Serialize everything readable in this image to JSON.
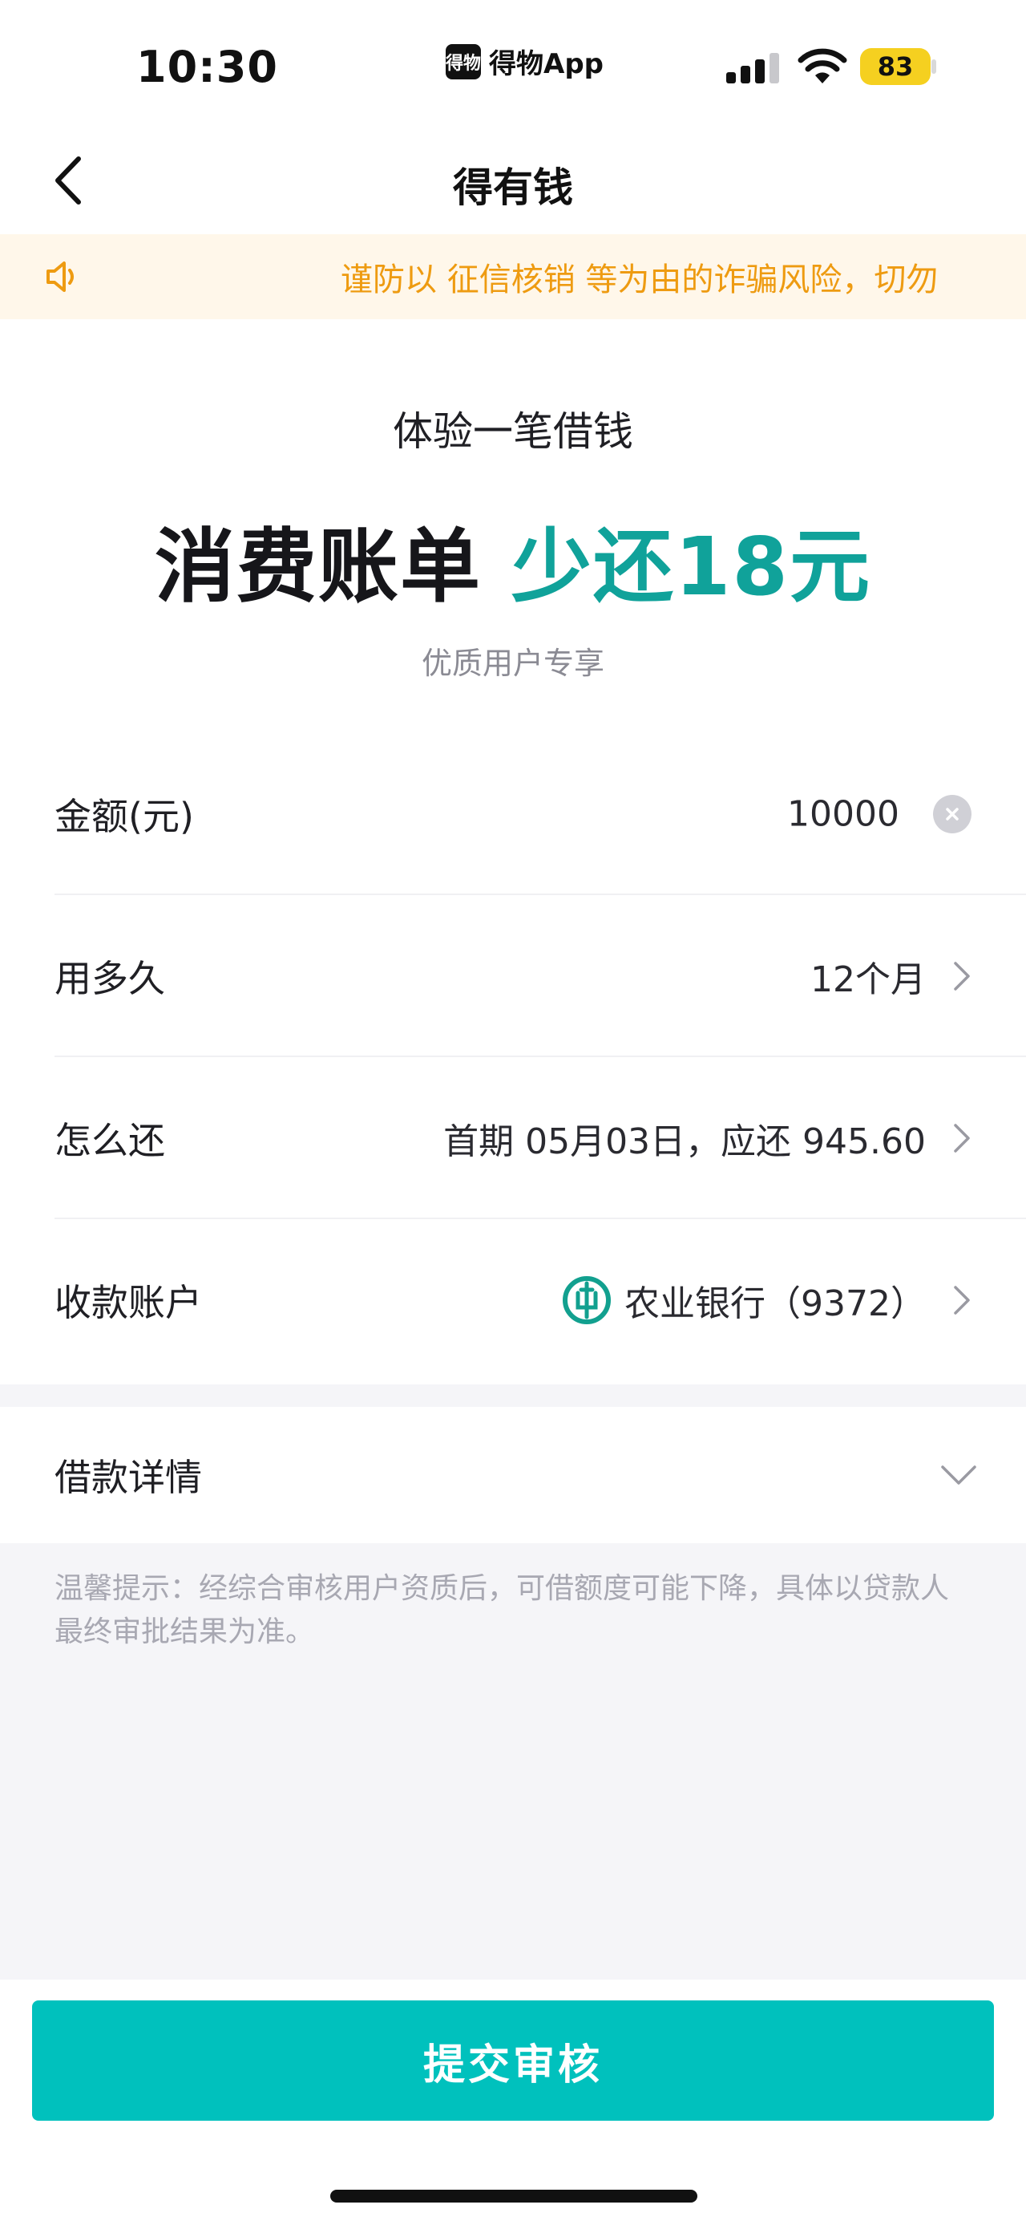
{
  "status_bar": {
    "time": "10:30",
    "app_logo_text": "得物",
    "app_name": "得物App",
    "battery": "83"
  },
  "nav": {
    "title": "得有钱"
  },
  "notice": {
    "text": "谨防以 征信核销 等为由的诈骗风险，切勿"
  },
  "promo": {
    "subtitle": "体验一笔借钱",
    "headline_dark": "消费账单 ",
    "headline_accent": "少还18元",
    "note": "优质用户专享"
  },
  "form": {
    "amount": {
      "label": "金额(元)",
      "value": "10000"
    },
    "duration": {
      "label": "用多久",
      "value": "12个月"
    },
    "repayment": {
      "label": "怎么还",
      "value": "首期 05月03日，应还 945.60"
    },
    "account": {
      "label": "收款账户",
      "value": "农业银行（9372）"
    }
  },
  "loan_detail": {
    "label": "借款详情"
  },
  "tips": {
    "text": "温馨提示：经综合审核用户资质后，可借额度可能下降，具体以贷款人最终审批结果为准。"
  },
  "submit": {
    "label": "提交审核"
  },
  "colors": {
    "accent": "#10a29a",
    "button": "#00c1bd",
    "notice": "#ee9b11"
  }
}
